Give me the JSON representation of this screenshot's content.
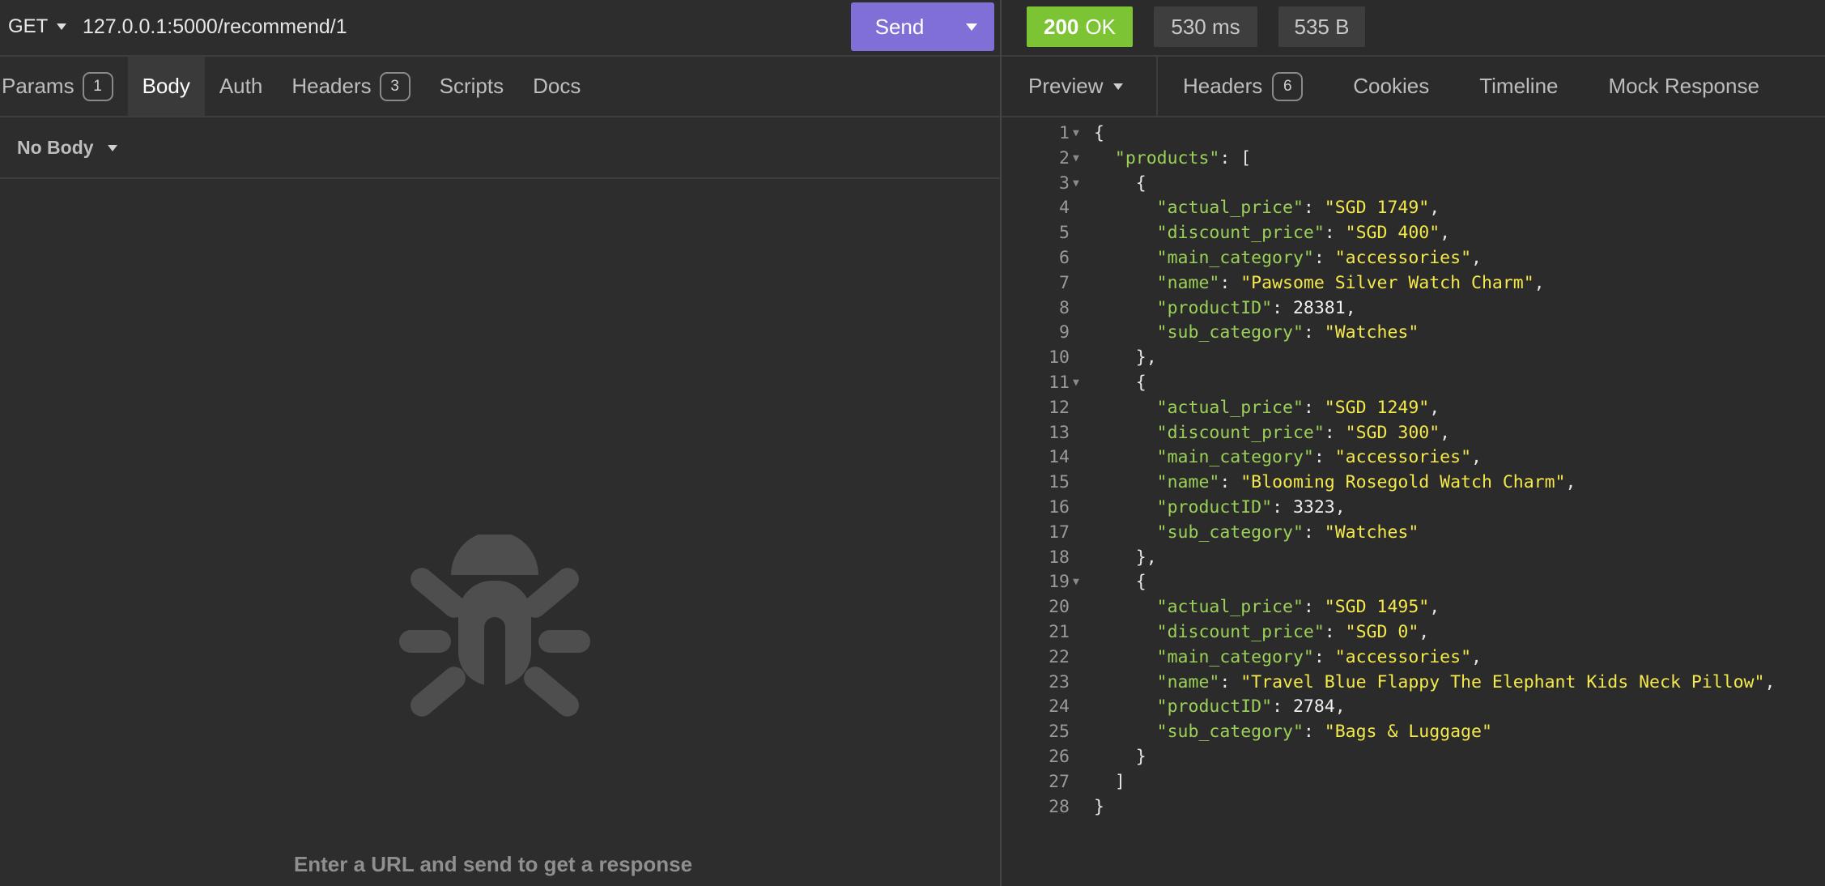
{
  "request": {
    "method": "GET",
    "url": "127.0.0.1:5000/recommend/1",
    "send_label": "Send",
    "tabs": [
      {
        "label": "Params",
        "badge": "1",
        "active": false
      },
      {
        "label": "Body",
        "badge": null,
        "active": true
      },
      {
        "label": "Auth",
        "badge": null,
        "active": false
      },
      {
        "label": "Headers",
        "badge": "3",
        "active": false
      },
      {
        "label": "Scripts",
        "badge": null,
        "active": false
      },
      {
        "label": "Docs",
        "badge": null,
        "active": false
      }
    ],
    "body_type": "No Body",
    "empty_message": "Enter a URL and send to get a response"
  },
  "response": {
    "status_code": "200",
    "status_text": "OK",
    "time": "530 ms",
    "size": "535 B",
    "tabs": [
      {
        "label": "Preview",
        "badge": null,
        "dropdown": true
      },
      {
        "label": "Headers",
        "badge": "6"
      },
      {
        "label": "Cookies",
        "badge": null
      },
      {
        "label": "Timeline",
        "badge": null
      },
      {
        "label": "Mock Response",
        "badge": null
      }
    ],
    "body": {
      "products": [
        {
          "actual_price": "SGD 1749",
          "discount_price": "SGD 400",
          "main_category": "accessories",
          "name": "Pawsome Silver Watch Charm",
          "productID": 28381,
          "sub_category": "Watches"
        },
        {
          "actual_price": "SGD 1249",
          "discount_price": "SGD 300",
          "main_category": "accessories",
          "name": "Blooming Rosegold Watch Charm",
          "productID": 3323,
          "sub_category": "Watches"
        },
        {
          "actual_price": "SGD 1495",
          "discount_price": "SGD 0",
          "main_category": "accessories",
          "name": "Travel Blue Flappy The Elephant Kids Neck Pillow",
          "productID": 2784,
          "sub_category": "Bags & Luggage"
        }
      ]
    }
  },
  "colors": {
    "accent": "#7f6fd6",
    "status_ok": "#7dc435",
    "json_key": "#9bd158",
    "json_string": "#f4e94a"
  },
  "icons": {
    "method_caret": "caret-down-icon",
    "send_dropdown": "caret-down-icon",
    "empty_state": "bug-icon"
  }
}
